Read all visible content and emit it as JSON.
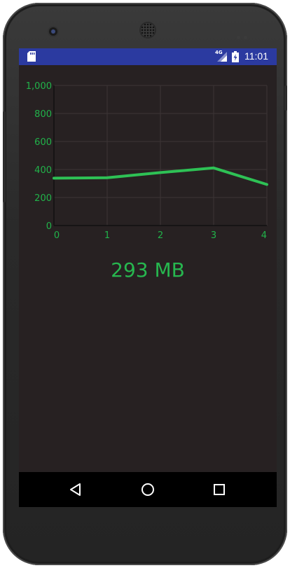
{
  "status_bar": {
    "network": "4G",
    "time": "11:01"
  },
  "chart_data": {
    "type": "line",
    "x": [
      0,
      1,
      2,
      3,
      4
    ],
    "values": [
      338,
      341,
      378,
      411,
      293
    ],
    "xlim": [
      0,
      4
    ],
    "ylim": [
      0,
      1000
    ],
    "x_ticks": [
      0,
      1,
      2,
      3,
      4
    ],
    "y_ticks": [
      0,
      200,
      400,
      600,
      800,
      1000
    ],
    "x_tick_labels": [
      "0",
      "1",
      "2",
      "3",
      "4"
    ],
    "y_tick_labels": [
      "0",
      "200",
      "400",
      "600",
      "800",
      "1,000"
    ],
    "grid": true,
    "title": "",
    "xlabel": "",
    "ylabel": "",
    "line_color": "#2ec155",
    "label_color": "#21b34a"
  },
  "memory": {
    "value_text": "293 MB"
  },
  "nav": {
    "back": "back-icon",
    "home": "home-icon",
    "recent": "recent-apps-icon"
  },
  "colors": {
    "status_bar": "#2b3aa0",
    "screen_bg": "#272122",
    "accent": "#27b74f",
    "nav_bar": "#000000"
  }
}
